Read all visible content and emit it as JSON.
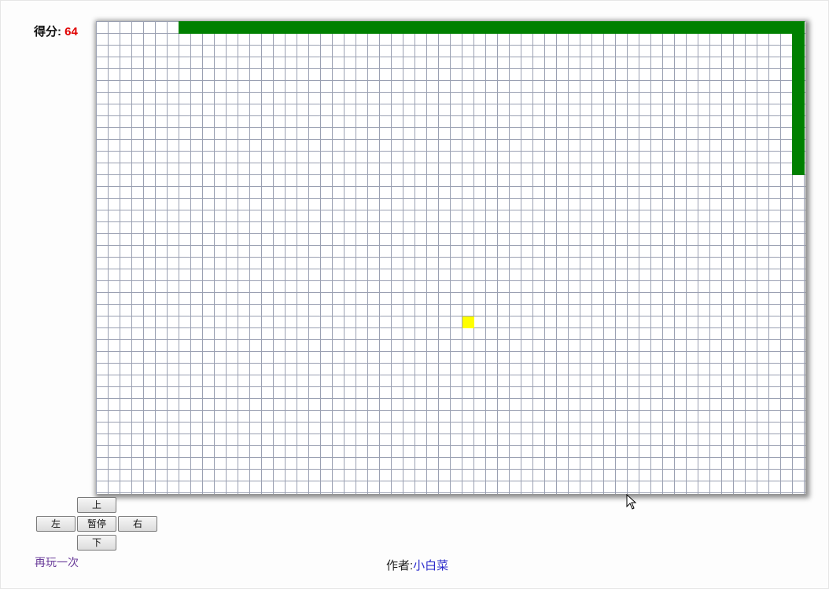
{
  "score": {
    "label": "得分:",
    "value": "64"
  },
  "board": {
    "cols": 60,
    "rows": 40,
    "snake_color": "#008000",
    "food_color": "#ffff00",
    "snake_cells": [
      [
        7,
        0
      ],
      [
        8,
        0
      ],
      [
        9,
        0
      ],
      [
        10,
        0
      ],
      [
        11,
        0
      ],
      [
        12,
        0
      ],
      [
        13,
        0
      ],
      [
        14,
        0
      ],
      [
        15,
        0
      ],
      [
        16,
        0
      ],
      [
        17,
        0
      ],
      [
        18,
        0
      ],
      [
        19,
        0
      ],
      [
        20,
        0
      ],
      [
        21,
        0
      ],
      [
        22,
        0
      ],
      [
        23,
        0
      ],
      [
        24,
        0
      ],
      [
        25,
        0
      ],
      [
        26,
        0
      ],
      [
        27,
        0
      ],
      [
        28,
        0
      ],
      [
        29,
        0
      ],
      [
        30,
        0
      ],
      [
        31,
        0
      ],
      [
        32,
        0
      ],
      [
        33,
        0
      ],
      [
        34,
        0
      ],
      [
        35,
        0
      ],
      [
        36,
        0
      ],
      [
        37,
        0
      ],
      [
        38,
        0
      ],
      [
        39,
        0
      ],
      [
        40,
        0
      ],
      [
        41,
        0
      ],
      [
        42,
        0
      ],
      [
        43,
        0
      ],
      [
        44,
        0
      ],
      [
        45,
        0
      ],
      [
        46,
        0
      ],
      [
        47,
        0
      ],
      [
        48,
        0
      ],
      [
        49,
        0
      ],
      [
        50,
        0
      ],
      [
        51,
        0
      ],
      [
        52,
        0
      ],
      [
        53,
        0
      ],
      [
        54,
        0
      ],
      [
        55,
        0
      ],
      [
        56,
        0
      ],
      [
        57,
        0
      ],
      [
        58,
        0
      ],
      [
        59,
        0
      ],
      [
        59,
        1
      ],
      [
        59,
        2
      ],
      [
        59,
        3
      ],
      [
        59,
        4
      ],
      [
        59,
        5
      ],
      [
        59,
        6
      ],
      [
        59,
        7
      ],
      [
        59,
        8
      ],
      [
        59,
        9
      ],
      [
        59,
        10
      ],
      [
        59,
        11
      ],
      [
        59,
        12
      ]
    ],
    "food_cell": [
      31,
      25
    ]
  },
  "controls": {
    "up": "上",
    "left": "左",
    "pause": "暂停",
    "right": "右",
    "down": "下"
  },
  "replay_label": "再玩一次",
  "author": {
    "label": "作者:",
    "name": "小白菜"
  }
}
